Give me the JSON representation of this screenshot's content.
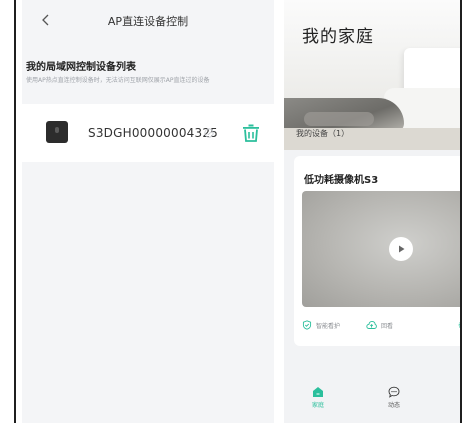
{
  "ap_panel": {
    "title": "AP直连设备控制",
    "section_heading": "我的局域网控制设备列表",
    "section_description": "使用AP热点直连控制设备时，无法访问互联网仅展示AP直连过的设备",
    "device": {
      "name": "S3DGH00000004325",
      "thumbnail": "camera-device-thumbnail",
      "verified_icon": "check-circle-icon",
      "delete_icon": "trash-icon"
    },
    "back_icon": "chevron-left-icon"
  },
  "home_panel": {
    "title": "我的家庭",
    "devices_label": "我的设备（1）",
    "camera": {
      "name": "低功耗摄像机S3",
      "play_icon": "play-icon",
      "actions": [
        {
          "label": "智能看护",
          "icon": "shield-check-icon"
        },
        {
          "label": "回看",
          "icon": "cloud-upload-icon"
        },
        {
          "label": "",
          "icon": "settings-icon"
        }
      ]
    },
    "tabs": [
      {
        "label": "家庭",
        "icon": "home-icon",
        "active": true
      },
      {
        "label": "动态",
        "icon": "chat-bubble-icon",
        "active": false
      }
    ]
  },
  "colors": {
    "accent": "#2bbf9c",
    "background": "#f4f5f7",
    "text": "#333333",
    "muted": "#9ea2a8"
  }
}
